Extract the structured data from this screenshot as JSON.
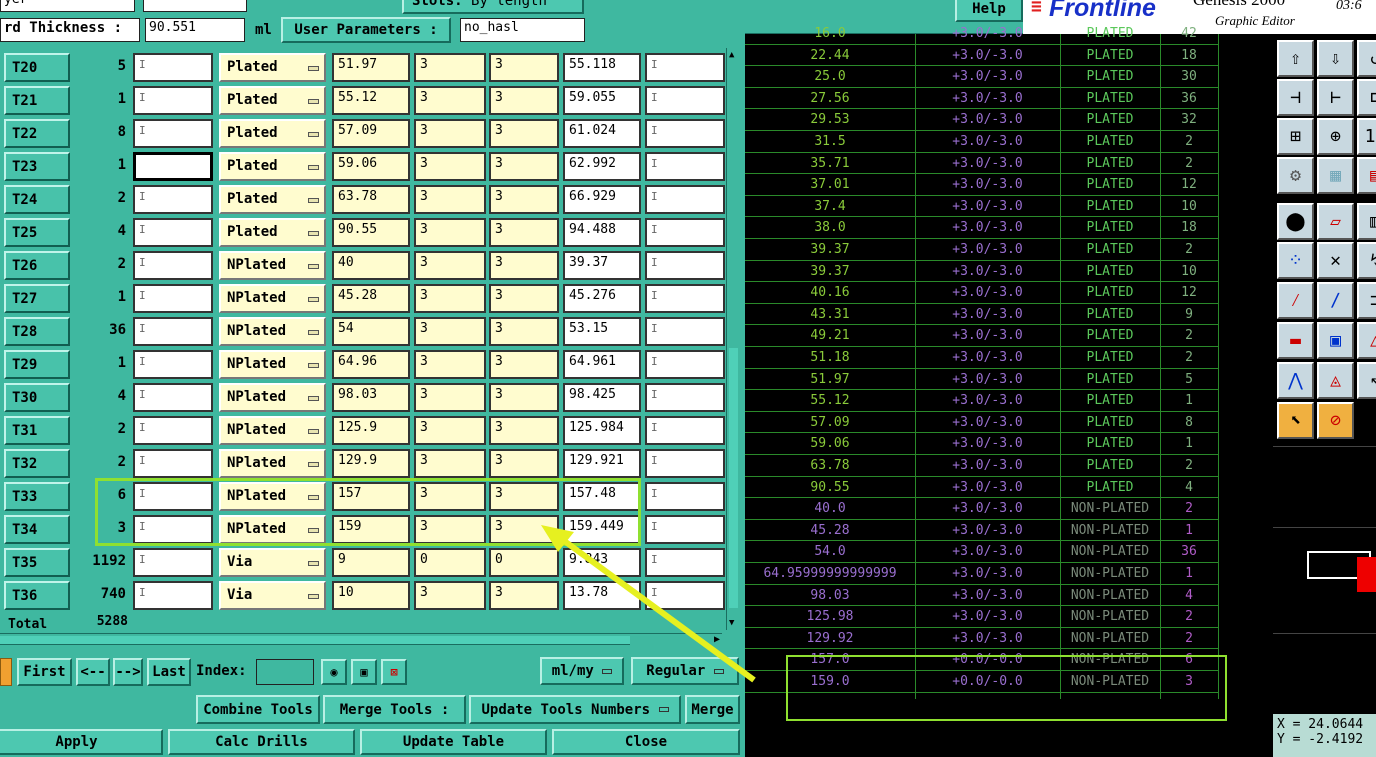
{
  "header": {
    "layer_label": "yer",
    "slots_label": "Slots:",
    "slots_value": "By length",
    "board_thickness_label": "rd Thickness :",
    "board_thickness_value": "90.551",
    "board_thickness_unit": "ml",
    "user_params_label": "User Parameters :",
    "user_params_value": "no_hasl"
  },
  "tools": [
    {
      "name": "T20",
      "count": "5",
      "type": "Plated",
      "size": "51.97",
      "tol_plus": "3",
      "tol_minus": "3",
      "finish": "55.118"
    },
    {
      "name": "T21",
      "count": "1",
      "type": "Plated",
      "size": "55.12",
      "tol_plus": "3",
      "tol_minus": "3",
      "finish": "59.055"
    },
    {
      "name": "T22",
      "count": "8",
      "type": "Plated",
      "size": "57.09",
      "tol_plus": "3",
      "tol_minus": "3",
      "finish": "61.024"
    },
    {
      "name": "T23",
      "count": "1",
      "type": "Plated",
      "size": "59.06",
      "tol_plus": "3",
      "tol_minus": "3",
      "finish": "62.992"
    },
    {
      "name": "T24",
      "count": "2",
      "type": "Plated",
      "size": "63.78",
      "tol_plus": "3",
      "tol_minus": "3",
      "finish": "66.929"
    },
    {
      "name": "T25",
      "count": "4",
      "type": "Plated",
      "size": "90.55",
      "tol_plus": "3",
      "tol_minus": "3",
      "finish": "94.488"
    },
    {
      "name": "T26",
      "count": "2",
      "type": "NPlated",
      "size": "40",
      "tol_plus": "3",
      "tol_minus": "3",
      "finish": "39.37"
    },
    {
      "name": "T27",
      "count": "1",
      "type": "NPlated",
      "size": "45.28",
      "tol_plus": "3",
      "tol_minus": "3",
      "finish": "45.276"
    },
    {
      "name": "T28",
      "count": "36",
      "type": "NPlated",
      "size": "54",
      "tol_plus": "3",
      "tol_minus": "3",
      "finish": "53.15"
    },
    {
      "name": "T29",
      "count": "1",
      "type": "NPlated",
      "size": "64.96",
      "tol_plus": "3",
      "tol_minus": "3",
      "finish": "64.961"
    },
    {
      "name": "T30",
      "count": "4",
      "type": "NPlated",
      "size": "98.03",
      "tol_plus": "3",
      "tol_minus": "3",
      "finish": "98.425"
    },
    {
      "name": "T31",
      "count": "2",
      "type": "NPlated",
      "size": "125.9",
      "tol_plus": "3",
      "tol_minus": "3",
      "finish": "125.984"
    },
    {
      "name": "T32",
      "count": "2",
      "type": "NPlated",
      "size": "129.9",
      "tol_plus": "3",
      "tol_minus": "3",
      "finish": "129.921"
    },
    {
      "name": "T33",
      "count": "6",
      "type": "NPlated",
      "size": "157",
      "tol_plus": "3",
      "tol_minus": "3",
      "finish": "157.48"
    },
    {
      "name": "T34",
      "count": "3",
      "type": "NPlated",
      "size": "159",
      "tol_plus": "3",
      "tol_minus": "3",
      "finish": "159.449"
    },
    {
      "name": "T35",
      "count": "1192",
      "type": "Via",
      "size": "9",
      "tol_plus": "0",
      "tol_minus": "0",
      "finish": "9.843"
    },
    {
      "name": "T36",
      "count": "740",
      "type": "Via",
      "size": "10",
      "tol_plus": "3",
      "tol_minus": "3",
      "finish": "13.78"
    }
  ],
  "total": {
    "label": "Total",
    "value": "5288"
  },
  "nav": {
    "first": "First",
    "prev": "<--",
    "next": "-->",
    "last": "Last",
    "index_label": "Index:",
    "index_value": "",
    "units": "ml/my",
    "mode": "Regular"
  },
  "actions": {
    "combine": "Combine Tools",
    "merge_label": "Merge Tools :",
    "update_numbers": "Update Tools Numbers",
    "merge": "Merge",
    "apply": "Apply",
    "calc": "Calc Drills",
    "update_table": "Update Table",
    "close": "Close"
  },
  "editor": {
    "help": "Help",
    "brand": "Frontline",
    "product": "Genesis 2000",
    "subtitle": "Graphic Editor",
    "time": "03:6",
    "coord_x": "X = 24.0644",
    "coord_y": "Y = -2.4192"
  },
  "drill_report": [
    {
      "size": "16.0",
      "tol": "+3.0/-3.0",
      "type": "PLATED",
      "count": "42"
    },
    {
      "size": "22.44",
      "tol": "+3.0/-3.0",
      "type": "PLATED",
      "count": "18"
    },
    {
      "size": "25.0",
      "tol": "+3.0/-3.0",
      "type": "PLATED",
      "count": "30"
    },
    {
      "size": "27.56",
      "tol": "+3.0/-3.0",
      "type": "PLATED",
      "count": "36"
    },
    {
      "size": "29.53",
      "tol": "+3.0/-3.0",
      "type": "PLATED",
      "count": "32"
    },
    {
      "size": "31.5",
      "tol": "+3.0/-3.0",
      "type": "PLATED",
      "count": "2"
    },
    {
      "size": "35.71",
      "tol": "+3.0/-3.0",
      "type": "PLATED",
      "count": "2"
    },
    {
      "size": "37.01",
      "tol": "+3.0/-3.0",
      "type": "PLATED",
      "count": "12"
    },
    {
      "size": "37.4",
      "tol": "+3.0/-3.0",
      "type": "PLATED",
      "count": "10"
    },
    {
      "size": "38.0",
      "tol": "+3.0/-3.0",
      "type": "PLATED",
      "count": "18"
    },
    {
      "size": "39.37",
      "tol": "+3.0/-3.0",
      "type": "PLATED",
      "count": "2"
    },
    {
      "size": "39.37",
      "tol": "+3.0/-3.0",
      "type": "PLATED",
      "count": "10"
    },
    {
      "size": "40.16",
      "tol": "+3.0/-3.0",
      "type": "PLATED",
      "count": "12"
    },
    {
      "size": "43.31",
      "tol": "+3.0/-3.0",
      "type": "PLATED",
      "count": "9"
    },
    {
      "size": "49.21",
      "tol": "+3.0/-3.0",
      "type": "PLATED",
      "count": "2"
    },
    {
      "size": "51.18",
      "tol": "+3.0/-3.0",
      "type": "PLATED",
      "count": "2"
    },
    {
      "size": "51.97",
      "tol": "+3.0/-3.0",
      "type": "PLATED",
      "count": "5"
    },
    {
      "size": "55.12",
      "tol": "+3.0/-3.0",
      "type": "PLATED",
      "count": "1"
    },
    {
      "size": "57.09",
      "tol": "+3.0/-3.0",
      "type": "PLATED",
      "count": "8"
    },
    {
      "size": "59.06",
      "tol": "+3.0/-3.0",
      "type": "PLATED",
      "count": "1"
    },
    {
      "size": "63.78",
      "tol": "+3.0/-3.0",
      "type": "PLATED",
      "count": "2"
    },
    {
      "size": "90.55",
      "tol": "+3.0/-3.0",
      "type": "PLATED",
      "count": "4"
    },
    {
      "size": "40.0",
      "tol": "+3.0/-3.0",
      "type": "NON-PLATED",
      "count": "2"
    },
    {
      "size": "45.28",
      "tol": "+3.0/-3.0",
      "type": "NON-PLATED",
      "count": "1"
    },
    {
      "size": "54.0",
      "tol": "+3.0/-3.0",
      "type": "NON-PLATED",
      "count": "36"
    },
    {
      "size": "64.95999999999999",
      "tol": "+3.0/-3.0",
      "type": "NON-PLATED",
      "count": "1"
    },
    {
      "size": "98.03",
      "tol": "+3.0/-3.0",
      "type": "NON-PLATED",
      "count": "4"
    },
    {
      "size": "125.98",
      "tol": "+3.0/-3.0",
      "type": "NON-PLATED",
      "count": "2"
    },
    {
      "size": "129.92",
      "tol": "+3.0/-3.0",
      "type": "NON-PLATED",
      "count": "2"
    },
    {
      "size": "157.0",
      "tol": "+0.0/-0.0",
      "type": "NON-PLATED",
      "count": "6"
    },
    {
      "size": "159.0",
      "tol": "+0.0/-0.0",
      "type": "NON-PLATED",
      "count": "3"
    }
  ],
  "colors": {
    "panel": "#3fb8a0",
    "highlight": "#8fe030",
    "arrow": "#e6f020"
  },
  "toolbar_icons": [
    "move-icon",
    "copy-icon",
    "rotate-icon",
    "mirror-icon",
    "resize-icon",
    "scale-icon",
    "break-icon",
    "grid-icon",
    "snap-icon",
    "pad-icon",
    "edit-icon",
    "ruler-icon",
    "connect-icon",
    "delete-icon",
    "reshape-icon",
    "line-icon",
    "line2-icon",
    "arc-icon",
    "tee-icon",
    "dash-icon",
    "frame-icon",
    "triangle-icon",
    "arrow-shape-icon",
    "polygon-icon",
    "select-icon",
    "select-box-icon",
    "stop-icon"
  ]
}
